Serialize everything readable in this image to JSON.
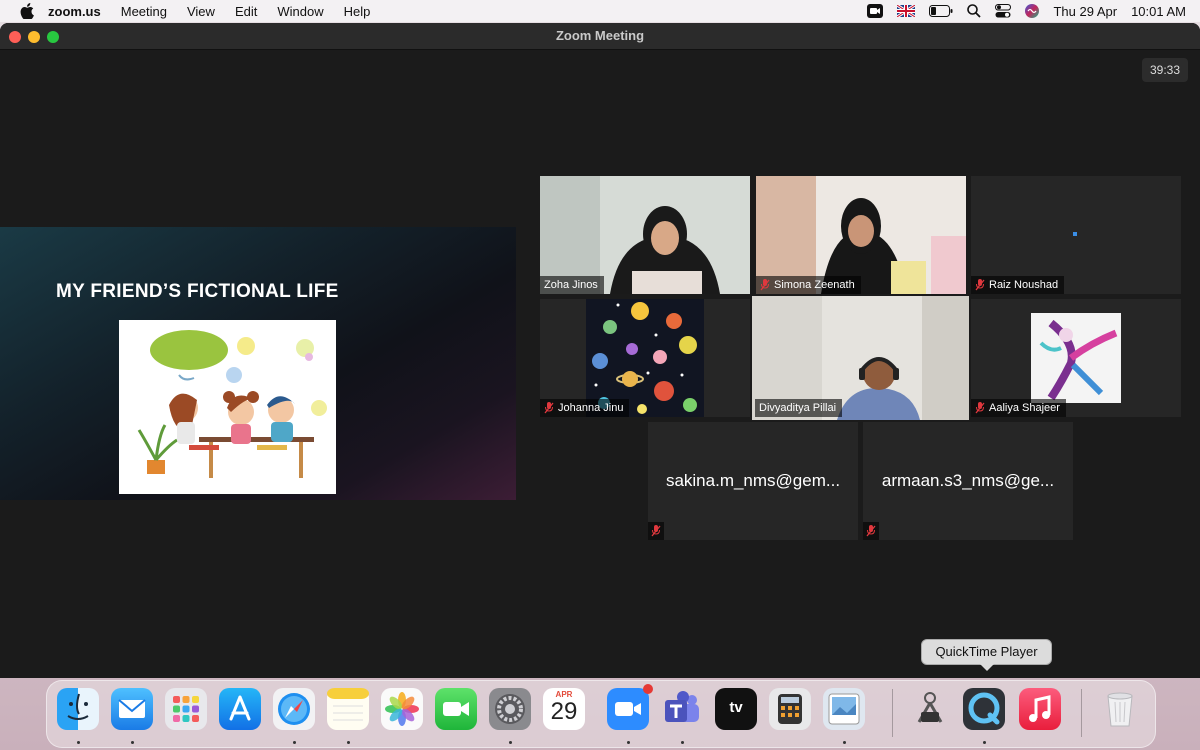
{
  "menubar": {
    "app_name": "zoom.us",
    "items": [
      "Meeting",
      "View",
      "Edit",
      "Window",
      "Help"
    ],
    "date": "Thu 29 Apr",
    "time": "10:01 AM"
  },
  "window": {
    "title": "Zoom Meeting",
    "timer": "39:33"
  },
  "shared_screen": {
    "slide_title": "MY FRIEND’S FICTIONAL LIFE"
  },
  "participants": [
    {
      "name": "Zoha Jinos",
      "muted": false
    },
    {
      "name": "Simona Zeenath",
      "muted": true
    },
    {
      "name": "Raiz Noushad",
      "muted": true
    },
    {
      "name": "Johanna Jinu",
      "muted": true
    },
    {
      "name": "Divyaditya Pillai",
      "muted": false,
      "active_speaker": true
    },
    {
      "name": "Aaliya Shajeer",
      "muted": true
    },
    {
      "name": "sakina.m_nms@gem...",
      "muted": true
    },
    {
      "name": "armaan.s3_nms@ge...",
      "muted": true
    }
  ],
  "dock": {
    "tooltip": "QuickTime Player",
    "calendar_month": "APR",
    "calendar_day": "29",
    "tv_label": "tv",
    "apps": [
      "Finder",
      "Mail",
      "Launchpad",
      "App Store",
      "Safari",
      "Notes",
      "Photos",
      "FaceTime",
      "System Preferences",
      "Calendar",
      "Zoom",
      "Microsoft Teams",
      "Apple TV",
      "Calculator",
      "Preview",
      "Instruments",
      "QuickTime Player",
      "Music",
      "Trash"
    ]
  },
  "colors": {
    "active_speaker_border": "#d7e36a",
    "mute_icon": "#e0383e",
    "window_bg": "#1b1b1b",
    "tile_bg": "#262626"
  }
}
